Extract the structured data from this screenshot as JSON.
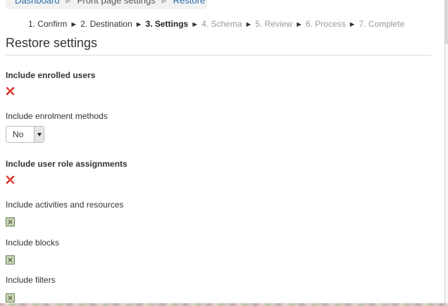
{
  "breadcrumb": {
    "items": [
      "Dashboard",
      "Front page settings",
      "Restore"
    ]
  },
  "steps": [
    {
      "label": "1. Confirm",
      "state": "done"
    },
    {
      "label": "2. Destination",
      "state": "done"
    },
    {
      "label": "3. Settings",
      "state": "current"
    },
    {
      "label": "4. Schema",
      "state": "future"
    },
    {
      "label": "5. Review",
      "state": "future"
    },
    {
      "label": "6. Process",
      "state": "future"
    },
    {
      "label": "7. Complete",
      "state": "future"
    }
  ],
  "step_arrow": "►",
  "page_title": "Restore settings",
  "settings": {
    "enrolled_users": {
      "label": "Include enrolled users",
      "icon": "red-cross-icon"
    },
    "enrolment_methods": {
      "label": "Include enrolment methods",
      "value": "No"
    },
    "role_assignments": {
      "label": "Include user role assignments",
      "icon": "red-cross-icon"
    },
    "activities": {
      "label": "Include activities and resources",
      "icon": "green-check-icon"
    },
    "blocks": {
      "label": "Include blocks",
      "icon": "green-check-icon"
    },
    "filters": {
      "label": "Include filters",
      "icon": "green-check-icon"
    }
  },
  "colors": {
    "link": "#2a6fb0",
    "cross": "#d9241c",
    "check_fill": "#c9d6b6",
    "check_border": "#6b7d57",
    "future_step": "#999999"
  }
}
